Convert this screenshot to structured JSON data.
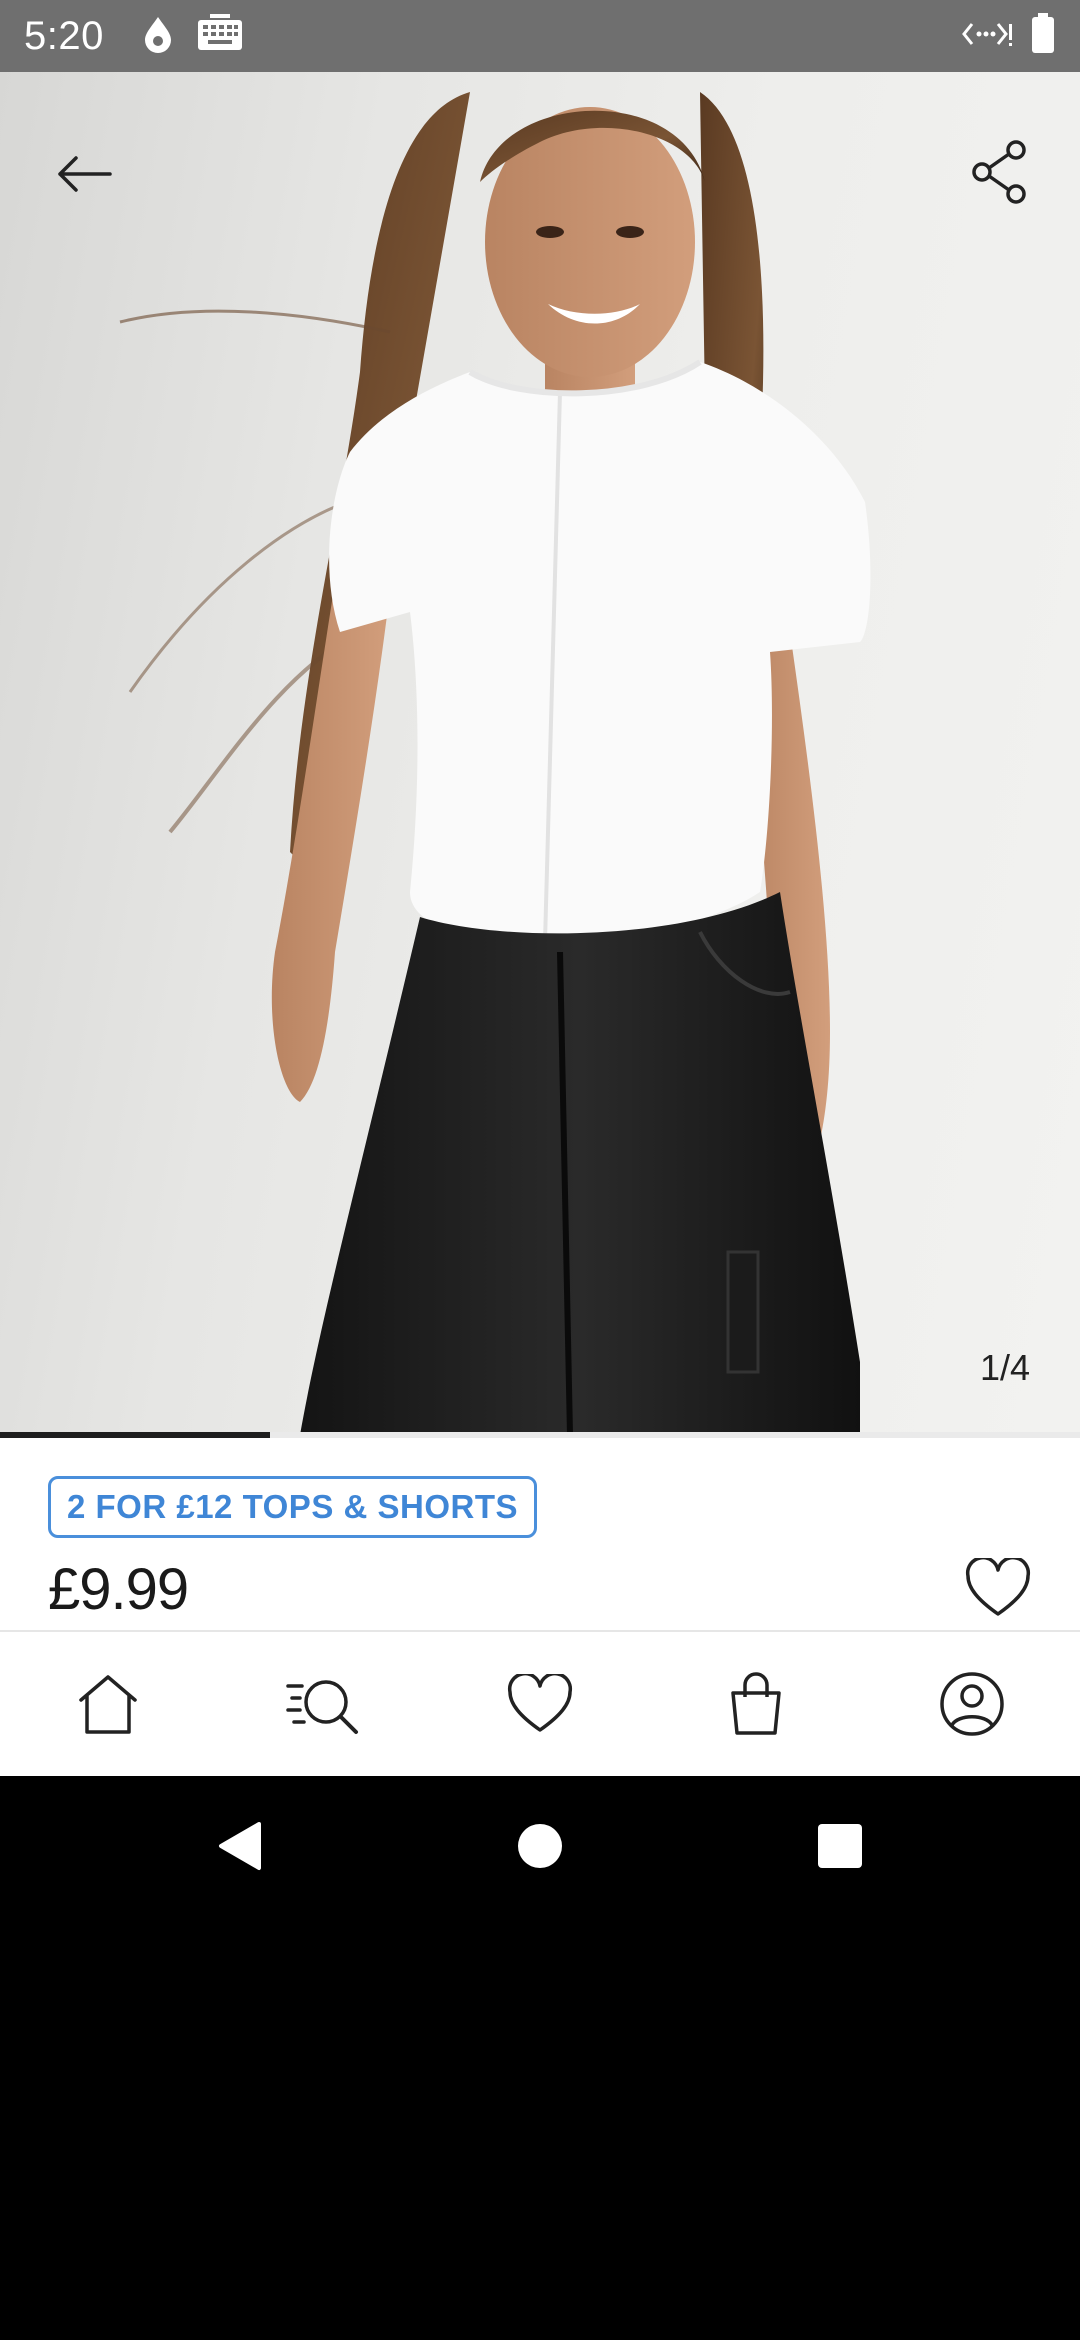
{
  "status_bar": {
    "time": "5:20",
    "icons": [
      "drop-icon",
      "keyboard-icon",
      "data-saver-icon",
      "battery-icon"
    ]
  },
  "gallery": {
    "counter": "1/4",
    "current_image": 1,
    "total_images": 4,
    "progress_fraction": 0.25,
    "back_icon": "arrow-left-icon",
    "share_icon": "share-icon"
  },
  "product": {
    "promo": "2 FOR £12 TOPS & SHORTS",
    "price": "£9.99",
    "wishlist_icon": "heart-icon"
  },
  "bottom_nav": {
    "items": [
      {
        "name": "home",
        "icon": "home-icon"
      },
      {
        "name": "search",
        "icon": "search-icon"
      },
      {
        "name": "wishlist",
        "icon": "heart-icon"
      },
      {
        "name": "bag",
        "icon": "bag-icon"
      },
      {
        "name": "account",
        "icon": "account-icon"
      }
    ]
  },
  "colors": {
    "promo_blue": "#3f86d6",
    "status_bar": "#6f6f6f",
    "text": "#1a1a1a"
  }
}
